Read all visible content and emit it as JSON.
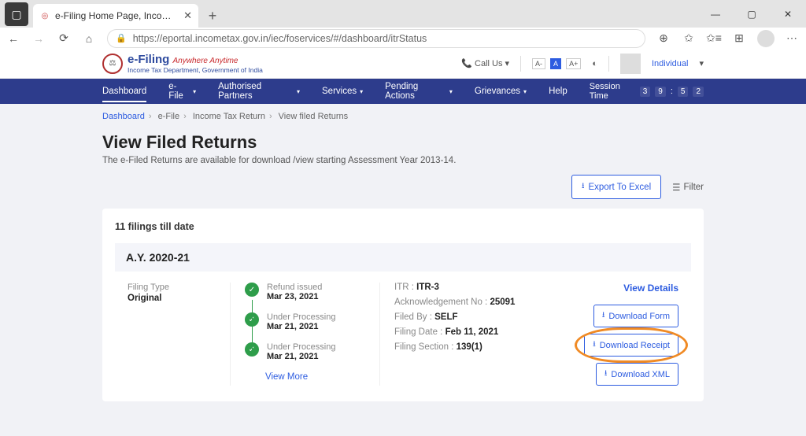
{
  "browser": {
    "tab_title": "e-Filing Home Page, Income Tax",
    "url": "https://eportal.incometax.gov.in/iec/foservices/#/dashboard/itrStatus"
  },
  "logo": {
    "brand": "e-Filing",
    "tag": "Anywhere Anytime",
    "dept": "Income Tax Department, Government of India"
  },
  "top": {
    "callus": "Call Us",
    "a_minus": "A-",
    "a_normal": "A",
    "a_plus": "A+",
    "user_type": "Individual"
  },
  "nav": {
    "dashboard": "Dashboard",
    "efile": "e-File",
    "partners": "Authorised Partners",
    "services": "Services",
    "pending": "Pending Actions",
    "grievances": "Grievances",
    "help": "Help",
    "session_label": "Session Time",
    "d1": "3",
    "d2": "9",
    "d3": "5",
    "d4": "2"
  },
  "crumbs": {
    "c1": "Dashboard",
    "c2": "e-File",
    "c3": "Income Tax Return",
    "c4": "View filed Returns"
  },
  "page": {
    "title": "View Filed Returns",
    "subtitle": "The e-Filed Returns are available for download /view starting Assessment Year 2013-14.",
    "export": "Export To Excel",
    "filter": "Filter"
  },
  "card": {
    "count": "11 filings till date",
    "ay": "A.Y. 2020-21",
    "filing_type_label": "Filing Type",
    "filing_type": "Original",
    "timeline": [
      {
        "status": "Refund issued",
        "date": "Mar 23, 2021"
      },
      {
        "status": "Under Processing",
        "date": "Mar 21, 2021"
      },
      {
        "status": "Under Processing",
        "date": "Mar 21, 2021"
      }
    ],
    "view_more": "View More",
    "details": {
      "itr_l": "ITR :",
      "itr_v": "ITR-3",
      "ack_l": "Acknowledgement No :",
      "ack_v": "25091",
      "by_l": "Filed By :",
      "by_v": "SELF",
      "date_l": "Filing Date :",
      "date_v": "Feb 11, 2021",
      "sec_l": "Filing Section :",
      "sec_v": "139(1)"
    },
    "actions": {
      "view_details": "View Details",
      "dl_form": "Download Form",
      "dl_receipt": "Download Receipt",
      "dl_xml": "Download XML"
    }
  }
}
